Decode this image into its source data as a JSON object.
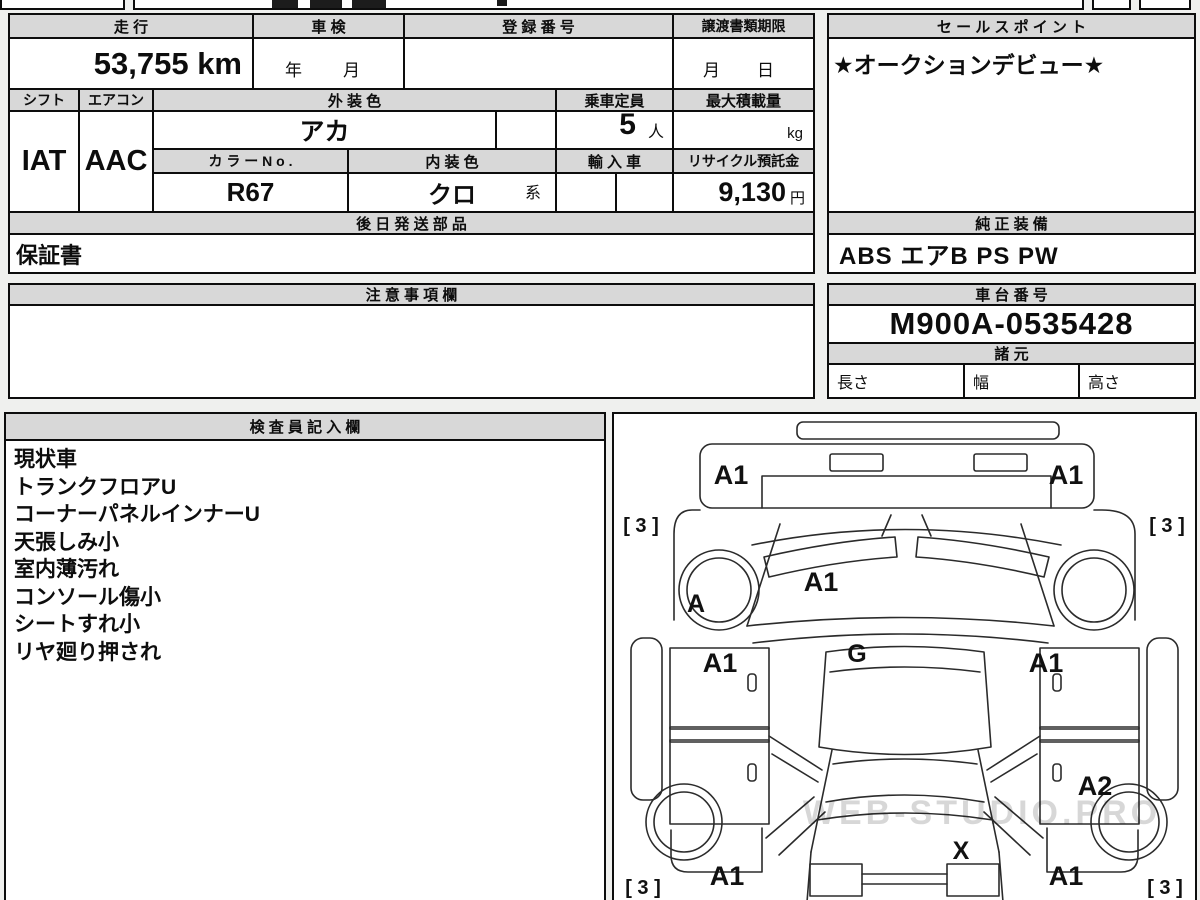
{
  "table": {
    "mileage_h": "走 行",
    "mileage_v": "53,755 km",
    "shaken_h": "車 検",
    "shaken_v": "年　月",
    "reg_h": "登 録 番 号",
    "transfer_h": "譲渡書類期限",
    "transfer_v": "月　日",
    "shift_h": "シフト",
    "shift_v": "IAT",
    "aircon_h": "エアコン",
    "aircon_v": "AAC",
    "ext_color_h": "外 装 色",
    "ext_color_v": "アカ",
    "capacity_h": "乗車定員",
    "capacity_v": "5",
    "capacity_unit": "人",
    "max_load_h": "最大積載量",
    "max_load_unit": "kg",
    "color_no_h": "カ ラ ー N o .",
    "color_no_v": "R67",
    "int_color_h": "内 装 色",
    "int_color_v": "クロ",
    "int_color_suffix": "系",
    "import_h": "輸 入 車",
    "recycle_h": "リサイクル預託金",
    "recycle_v": "9,130",
    "recycle_unit": "円"
  },
  "sales_point": {
    "header": "セ ー ル ス ポ イ ン ト",
    "value": "★オークションデビュー★"
  },
  "later_parts": {
    "header": "後 日 発 送 部 品",
    "value": "保証書"
  },
  "equipment": {
    "header": "純 正 装 備",
    "value": "ABS エアB PS PW"
  },
  "notes": {
    "header": "注 意 事 項 欄"
  },
  "chassis": {
    "header": "車 台 番 号",
    "value": "M900A-0535428"
  },
  "specs": {
    "header": "諸 元",
    "length_label": "長さ",
    "width_label": "幅",
    "height_label": "高さ"
  },
  "inspector": {
    "header": "検 査 員 記 入 欄",
    "lines": [
      "現状車",
      "トランクフロアU",
      "コーナーパネルインナーU",
      "天張しみ小",
      "室内薄汚れ",
      "コンソール傷小",
      "シートすれ小",
      "リヤ廻り押され"
    ]
  },
  "diagram": {
    "labels": [
      "A1",
      "A1",
      "[ 3 ]",
      "[ 3 ]",
      "A",
      "A1",
      "G",
      "A1",
      "A1",
      "A2",
      "A1",
      "X",
      "A1",
      "[ 3 ]",
      "[ 3 ]"
    ],
    "watermark": "WEB-STUDIO.PRO"
  }
}
